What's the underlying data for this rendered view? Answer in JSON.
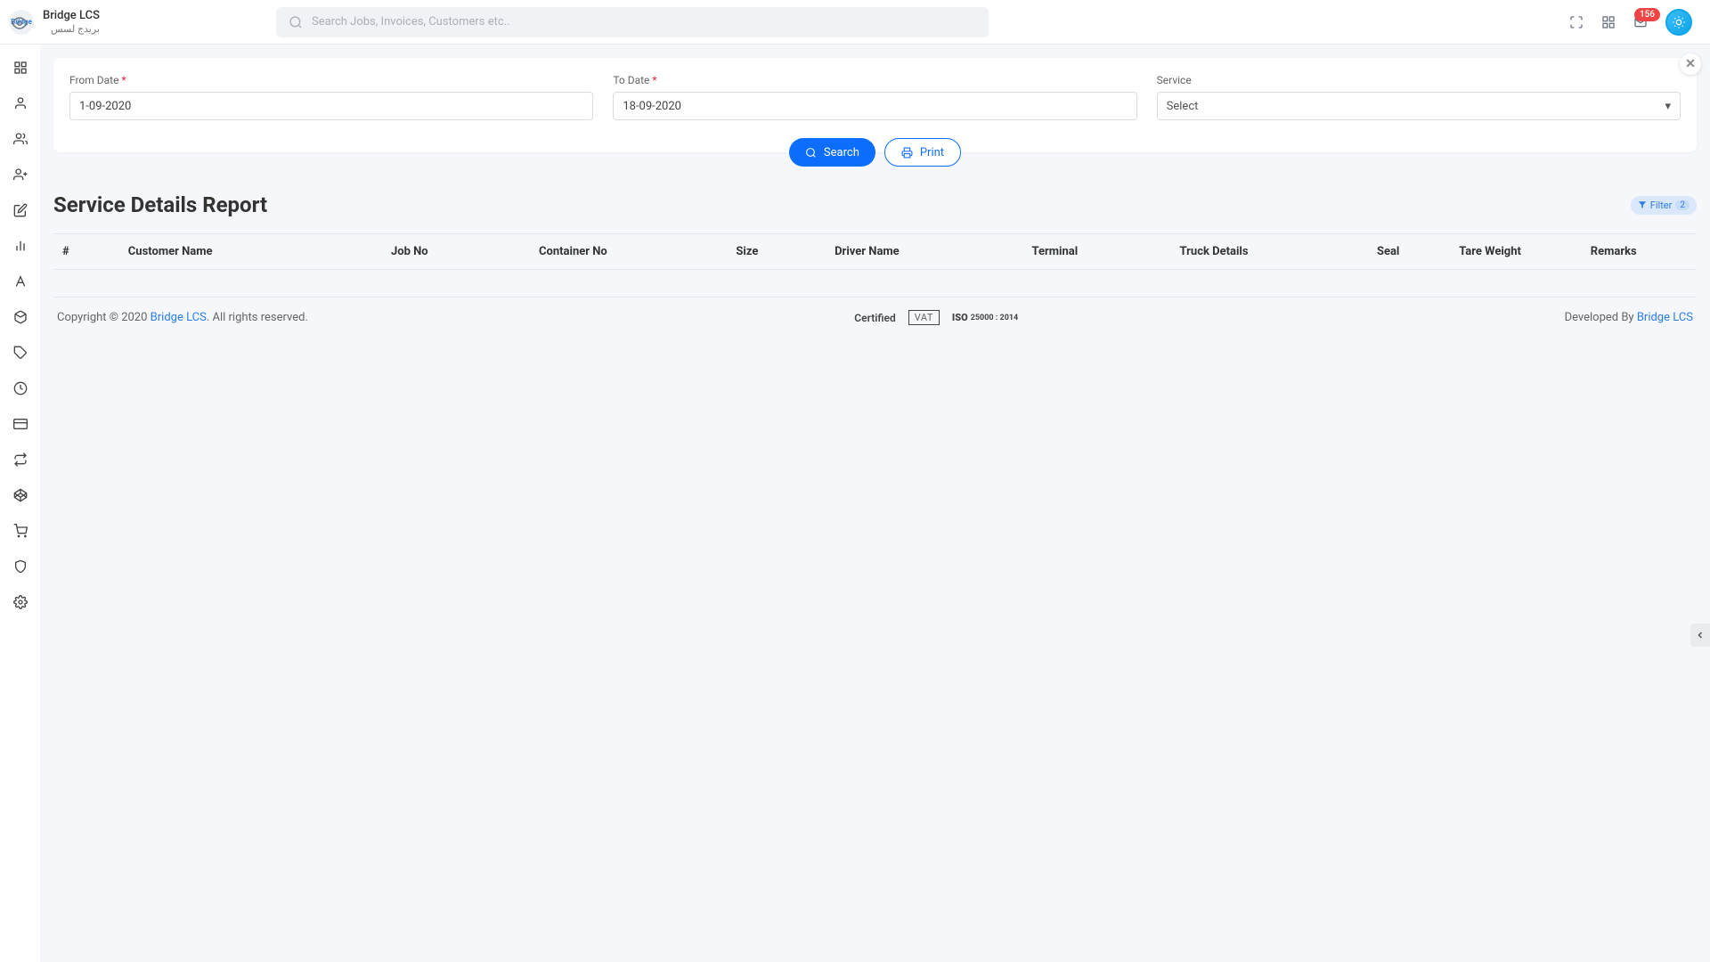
{
  "brand": {
    "title": "Bridge LCS",
    "subtitle": "بريدج لسس",
    "logo_text": "Bridge"
  },
  "search": {
    "placeholder": "Search Jobs, Invoices, Customers etc.."
  },
  "header": {
    "badge": "156"
  },
  "filters": {
    "from_label": "From Date",
    "to_label": "To Date",
    "service_label": "Service",
    "from_value": "1-09-2020",
    "to_value": "18-09-2020",
    "service_value": "Select",
    "search_btn": "Search",
    "print_btn": "Print"
  },
  "report": {
    "title": "Service Details Report",
    "filter_pill": "Filter",
    "filter_count": "2"
  },
  "table_headers": [
    "#",
    "Customer Name",
    "Job No",
    "Container No",
    "Size",
    "Driver Name",
    "Terminal",
    "Truck Details",
    "Seal",
    "Tare Weight",
    "Remarks"
  ],
  "footer": {
    "prefix": "Copyright © 2020 ",
    "link": "Bridge LCS",
    "suffix": ". All rights reserved.",
    "dev_prefix": "Developed By ",
    "dev_link": "Bridge LCS",
    "cert_certified": "Certified",
    "cert_vat": "VAT",
    "cert_iso": "25000 : 2014"
  }
}
